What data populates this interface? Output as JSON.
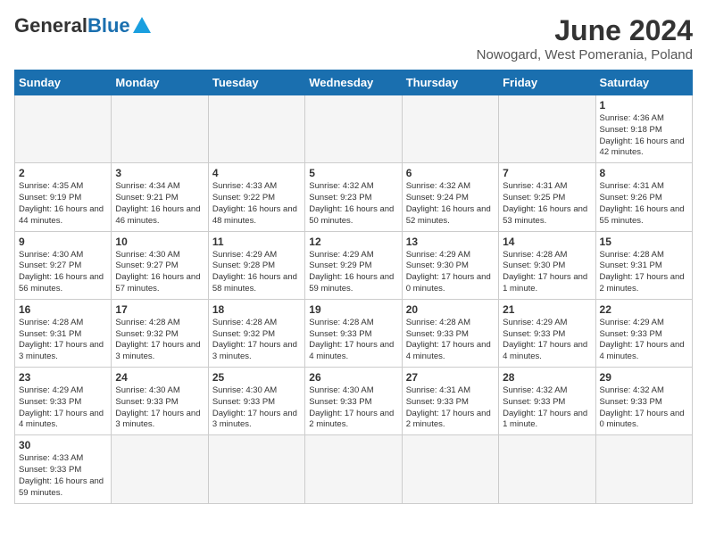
{
  "logo": {
    "general": "General",
    "blue": "Blue"
  },
  "title": "June 2024",
  "location": "Nowogard, West Pomerania, Poland",
  "days_of_week": [
    "Sunday",
    "Monday",
    "Tuesday",
    "Wednesday",
    "Thursday",
    "Friday",
    "Saturday"
  ],
  "weeks": [
    [
      {
        "day": "",
        "info": ""
      },
      {
        "day": "",
        "info": ""
      },
      {
        "day": "",
        "info": ""
      },
      {
        "day": "",
        "info": ""
      },
      {
        "day": "",
        "info": ""
      },
      {
        "day": "",
        "info": ""
      },
      {
        "day": "1",
        "info": "Sunrise: 4:36 AM\nSunset: 9:18 PM\nDaylight: 16 hours and 42 minutes."
      }
    ],
    [
      {
        "day": "2",
        "info": "Sunrise: 4:35 AM\nSunset: 9:19 PM\nDaylight: 16 hours and 44 minutes."
      },
      {
        "day": "3",
        "info": "Sunrise: 4:34 AM\nSunset: 9:21 PM\nDaylight: 16 hours and 46 minutes."
      },
      {
        "day": "4",
        "info": "Sunrise: 4:33 AM\nSunset: 9:22 PM\nDaylight: 16 hours and 48 minutes."
      },
      {
        "day": "5",
        "info": "Sunrise: 4:32 AM\nSunset: 9:23 PM\nDaylight: 16 hours and 50 minutes."
      },
      {
        "day": "6",
        "info": "Sunrise: 4:32 AM\nSunset: 9:24 PM\nDaylight: 16 hours and 52 minutes."
      },
      {
        "day": "7",
        "info": "Sunrise: 4:31 AM\nSunset: 9:25 PM\nDaylight: 16 hours and 53 minutes."
      },
      {
        "day": "8",
        "info": "Sunrise: 4:31 AM\nSunset: 9:26 PM\nDaylight: 16 hours and 55 minutes."
      }
    ],
    [
      {
        "day": "9",
        "info": "Sunrise: 4:30 AM\nSunset: 9:27 PM\nDaylight: 16 hours and 56 minutes."
      },
      {
        "day": "10",
        "info": "Sunrise: 4:30 AM\nSunset: 9:27 PM\nDaylight: 16 hours and 57 minutes."
      },
      {
        "day": "11",
        "info": "Sunrise: 4:29 AM\nSunset: 9:28 PM\nDaylight: 16 hours and 58 minutes."
      },
      {
        "day": "12",
        "info": "Sunrise: 4:29 AM\nSunset: 9:29 PM\nDaylight: 16 hours and 59 minutes."
      },
      {
        "day": "13",
        "info": "Sunrise: 4:29 AM\nSunset: 9:30 PM\nDaylight: 17 hours and 0 minutes."
      },
      {
        "day": "14",
        "info": "Sunrise: 4:28 AM\nSunset: 9:30 PM\nDaylight: 17 hours and 1 minute."
      },
      {
        "day": "15",
        "info": "Sunrise: 4:28 AM\nSunset: 9:31 PM\nDaylight: 17 hours and 2 minutes."
      }
    ],
    [
      {
        "day": "16",
        "info": "Sunrise: 4:28 AM\nSunset: 9:31 PM\nDaylight: 17 hours and 3 minutes."
      },
      {
        "day": "17",
        "info": "Sunrise: 4:28 AM\nSunset: 9:32 PM\nDaylight: 17 hours and 3 minutes."
      },
      {
        "day": "18",
        "info": "Sunrise: 4:28 AM\nSunset: 9:32 PM\nDaylight: 17 hours and 3 minutes."
      },
      {
        "day": "19",
        "info": "Sunrise: 4:28 AM\nSunset: 9:33 PM\nDaylight: 17 hours and 4 minutes."
      },
      {
        "day": "20",
        "info": "Sunrise: 4:28 AM\nSunset: 9:33 PM\nDaylight: 17 hours and 4 minutes."
      },
      {
        "day": "21",
        "info": "Sunrise: 4:29 AM\nSunset: 9:33 PM\nDaylight: 17 hours and 4 minutes."
      },
      {
        "day": "22",
        "info": "Sunrise: 4:29 AM\nSunset: 9:33 PM\nDaylight: 17 hours and 4 minutes."
      }
    ],
    [
      {
        "day": "23",
        "info": "Sunrise: 4:29 AM\nSunset: 9:33 PM\nDaylight: 17 hours and 4 minutes."
      },
      {
        "day": "24",
        "info": "Sunrise: 4:30 AM\nSunset: 9:33 PM\nDaylight: 17 hours and 3 minutes."
      },
      {
        "day": "25",
        "info": "Sunrise: 4:30 AM\nSunset: 9:33 PM\nDaylight: 17 hours and 3 minutes."
      },
      {
        "day": "26",
        "info": "Sunrise: 4:30 AM\nSunset: 9:33 PM\nDaylight: 17 hours and 2 minutes."
      },
      {
        "day": "27",
        "info": "Sunrise: 4:31 AM\nSunset: 9:33 PM\nDaylight: 17 hours and 2 minutes."
      },
      {
        "day": "28",
        "info": "Sunrise: 4:32 AM\nSunset: 9:33 PM\nDaylight: 17 hours and 1 minute."
      },
      {
        "day": "29",
        "info": "Sunrise: 4:32 AM\nSunset: 9:33 PM\nDaylight: 17 hours and 0 minutes."
      }
    ],
    [
      {
        "day": "30",
        "info": "Sunrise: 4:33 AM\nSunset: 9:33 PM\nDaylight: 16 hours and 59 minutes."
      },
      {
        "day": "",
        "info": ""
      },
      {
        "day": "",
        "info": ""
      },
      {
        "day": "",
        "info": ""
      },
      {
        "day": "",
        "info": ""
      },
      {
        "day": "",
        "info": ""
      },
      {
        "day": "",
        "info": ""
      }
    ]
  ]
}
